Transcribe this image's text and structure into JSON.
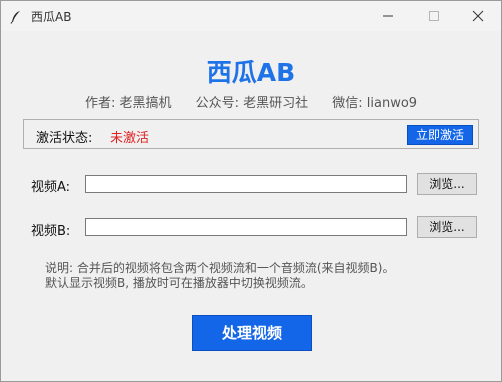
{
  "window": {
    "title": "西瓜AB",
    "icon": "feather-icon",
    "controls": [
      "minimize-icon",
      "maximize-icon",
      "close-icon"
    ]
  },
  "header": {
    "app_name": "西瓜AB",
    "author": "作者: 老黑搞机",
    "official_account": "公众号: 老黑研习社",
    "wechat": "微信: lianwo9"
  },
  "activation": {
    "label": "激活状态:",
    "status": "未激活",
    "status_color": "#e02020",
    "button_label": "立即激活"
  },
  "video_a": {
    "label": "视频A:",
    "value": "",
    "browse_label": "浏览..."
  },
  "video_b": {
    "label": "视频B:",
    "value": "",
    "browse_label": "浏览..."
  },
  "note": {
    "line1": "说明: 合并后的视频将包含两个视频流和一个音频流(来自视频B)。",
    "line2": "默认显示视频B, 播放时可在播放器中切换视频流。"
  },
  "actions": {
    "process_label": "处理视频"
  },
  "colors": {
    "accent": "#1466e8",
    "title": "#1e73e8",
    "inactive": "#e02020"
  }
}
